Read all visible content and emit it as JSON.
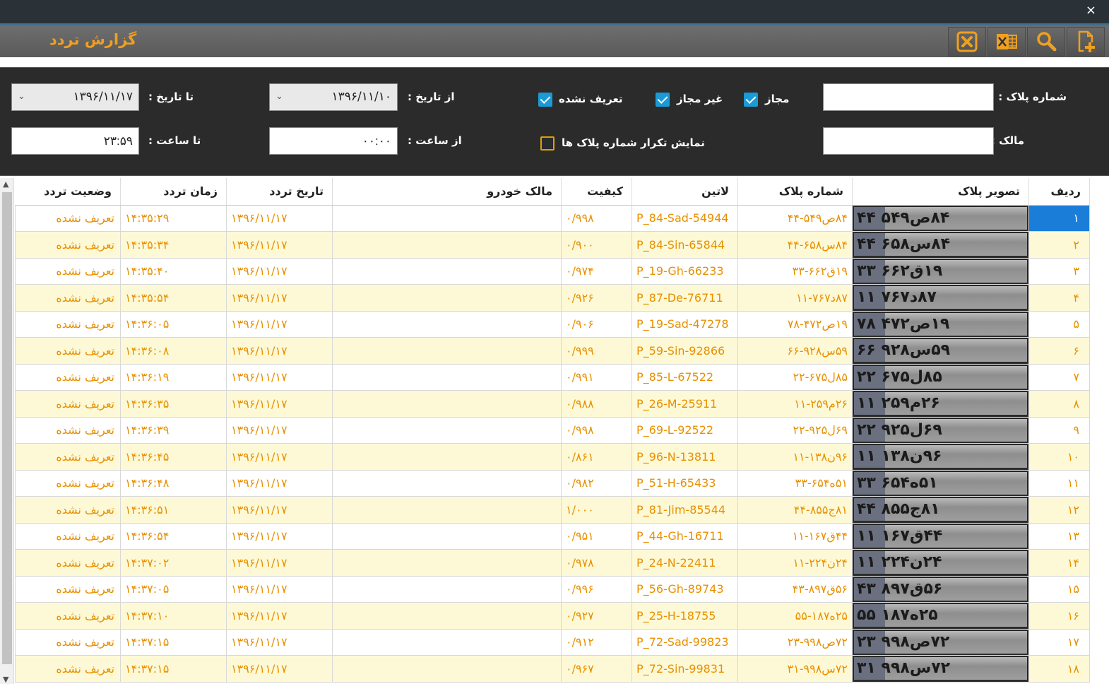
{
  "window": {
    "title": "گزارش تردد",
    "close_glyph": "×"
  },
  "toolbar": {
    "buttons": [
      {
        "name": "add-icon",
        "color": "#f0a020"
      },
      {
        "name": "search-icon",
        "color": "#f0a020"
      },
      {
        "name": "excel-icon",
        "color": "#f0a020"
      },
      {
        "name": "close-icon",
        "color": "#f0a020"
      }
    ]
  },
  "filters": {
    "plate_label": "شماره پلاک :",
    "owner_label": "مالک :",
    "plate_value": "",
    "owner_value": "",
    "allowed_label": "مجاز",
    "allowed_checked": true,
    "not_allowed_label": "غیر مجاز",
    "not_allowed_checked": true,
    "undefined_label": "تعریف نشده",
    "undefined_checked": true,
    "show_repeat_label": "نمایش تکرار شماره پلاک ها",
    "show_repeat_checked": false,
    "from_date_label": "از تاریخ :",
    "from_date_value": "۱۳۹۶/۱۱/۱۰",
    "to_date_label": "تا تاریخ :",
    "to_date_value": "۱۳۹۶/۱۱/۱۷",
    "from_time_label": "از ساعت :",
    "from_time_value": "۰۰:۰۰",
    "to_time_label": "تا ساعت :",
    "to_time_value": "۲۳:۵۹"
  },
  "table": {
    "headers": {
      "index": "ردیف",
      "image": "تصویر پلاک",
      "plate": "شماره پلاک",
      "latin": "لاتین",
      "quality": "کیفیت",
      "owner": "مالک خودرو",
      "date": "تاریخ تردد",
      "time": "زمان تردد",
      "status": "وضعیت تردد"
    },
    "rows": [
      {
        "index": "۱",
        "plate": "۸۴ص۵۴۹-۴۴",
        "image_text": "۸۴ص۵۴۹ ۴۴",
        "latin": "P_84-Sad-54944",
        "quality": "۰/۹۹۸",
        "owner": "",
        "date": "۱۳۹۶/۱۱/۱۷",
        "time": "۱۴:۳۵:۲۹",
        "status": "تعریف نشده"
      },
      {
        "index": "۲",
        "plate": "۸۴س۶۵۸-۴۴",
        "image_text": "۸۴س۶۵۸ ۴۴",
        "latin": "P_84-Sin-65844",
        "quality": "۰/۹۰۰",
        "owner": "",
        "date": "۱۳۹۶/۱۱/۱۷",
        "time": "۱۴:۳۵:۳۴",
        "status": "تعریف نشده"
      },
      {
        "index": "۳",
        "plate": "۱۹ق۶۶۲-۳۳",
        "image_text": "۱۹ق۶۶۲ ۳۳",
        "latin": "P_19-Gh-66233",
        "quality": "۰/۹۷۴",
        "owner": "",
        "date": "۱۳۹۶/۱۱/۱۷",
        "time": "۱۴:۳۵:۴۰",
        "status": "تعریف نشده"
      },
      {
        "index": "۴",
        "plate": "۸۷د۷۶۷-۱۱",
        "image_text": "۸۷د۷۶۷ ۱۱",
        "latin": "P_87-De-76711",
        "quality": "۰/۹۲۶",
        "owner": "",
        "date": "۱۳۹۶/۱۱/۱۷",
        "time": "۱۴:۳۵:۵۴",
        "status": "تعریف نشده"
      },
      {
        "index": "۵",
        "plate": "۱۹ص۴۷۲-۷۸",
        "image_text": "۱۹ص۴۷۲ ۷۸",
        "latin": "P_19-Sad-47278",
        "quality": "۰/۹۰۶",
        "owner": "",
        "date": "۱۳۹۶/۱۱/۱۷",
        "time": "۱۴:۳۶:۰۵",
        "status": "تعریف نشده"
      },
      {
        "index": "۶",
        "plate": "۵۹س۹۲۸-۶۶",
        "image_text": "۵۹س۹۲۸ ۶۶",
        "latin": "P_59-Sin-92866",
        "quality": "۰/۹۹۹",
        "owner": "",
        "date": "۱۳۹۶/۱۱/۱۷",
        "time": "۱۴:۳۶:۰۸",
        "status": "تعریف نشده"
      },
      {
        "index": "۷",
        "plate": "۸۵ل۶۷۵-۲۲",
        "image_text": "۸۵ل۶۷۵ ۲۲",
        "latin": "P_85-L-67522",
        "quality": "۰/۹۹۱",
        "owner": "",
        "date": "۱۳۹۶/۱۱/۱۷",
        "time": "۱۴:۳۶:۱۹",
        "status": "تعریف نشده"
      },
      {
        "index": "۸",
        "plate": "۲۶م۲۵۹-۱۱",
        "image_text": "۲۶م۲۵۹ ۱۱",
        "latin": "P_26-M-25911",
        "quality": "۰/۹۸۸",
        "owner": "",
        "date": "۱۳۹۶/۱۱/۱۷",
        "time": "۱۴:۳۶:۳۵",
        "status": "تعریف نشده"
      },
      {
        "index": "۹",
        "plate": "۶۹ل۹۲۵-۲۲",
        "image_text": "۶۹ل۹۲۵ ۲۲",
        "latin": "P_69-L-92522",
        "quality": "۰/۹۹۸",
        "owner": "",
        "date": "۱۳۹۶/۱۱/۱۷",
        "time": "۱۴:۳۶:۳۹",
        "status": "تعریف نشده"
      },
      {
        "index": "۱۰",
        "plate": "۹۶ن۱۳۸-۱۱",
        "image_text": "۹۶ن۱۳۸ ۱۱",
        "latin": "P_96-N-13811",
        "quality": "۰/۸۶۱",
        "owner": "",
        "date": "۱۳۹۶/۱۱/۱۷",
        "time": "۱۴:۳۶:۴۵",
        "status": "تعریف نشده"
      },
      {
        "index": "۱۱",
        "plate": "۵۱ه۶۵۴-۳۳",
        "image_text": "۵۱ه۶۵۴ ۳۳",
        "latin": "P_51-H-65433",
        "quality": "۰/۹۸۲",
        "owner": "",
        "date": "۱۳۹۶/۱۱/۱۷",
        "time": "۱۴:۳۶:۴۸",
        "status": "تعریف نشده"
      },
      {
        "index": "۱۲",
        "plate": "۸۱ج۸۵۵-۴۴",
        "image_text": "۸۱ج۸۵۵ ۴۴",
        "latin": "P_81-Jim-85544",
        "quality": "۱/۰۰۰",
        "owner": "",
        "date": "۱۳۹۶/۱۱/۱۷",
        "time": "۱۴:۳۶:۵۱",
        "status": "تعریف نشده"
      },
      {
        "index": "۱۳",
        "plate": "۴۴ق۱۶۷-۱۱",
        "image_text": "۴۴ق۱۶۷ ۱۱",
        "latin": "P_44-Gh-16711",
        "quality": "۰/۹۵۱",
        "owner": "",
        "date": "۱۳۹۶/۱۱/۱۷",
        "time": "۱۴:۳۶:۵۴",
        "status": "تعریف نشده"
      },
      {
        "index": "۱۴",
        "plate": "۲۴ن۲۲۴-۱۱",
        "image_text": "۲۴ن۲۲۴ ۱۱",
        "latin": "P_24-N-22411",
        "quality": "۰/۹۷۸",
        "owner": "",
        "date": "۱۳۹۶/۱۱/۱۷",
        "time": "۱۴:۳۷:۰۲",
        "status": "تعریف نشده"
      },
      {
        "index": "۱۵",
        "plate": "۵۶ق۸۹۷-۴۳",
        "image_text": "۵۶ق۸۹۷ ۴۳",
        "latin": "P_56-Gh-89743",
        "quality": "۰/۹۹۶",
        "owner": "",
        "date": "۱۳۹۶/۱۱/۱۷",
        "time": "۱۴:۳۷:۰۵",
        "status": "تعریف نشده"
      },
      {
        "index": "۱۶",
        "plate": "۲۵ه۱۸۷-۵۵",
        "image_text": "۲۵ه۱۸۷ ۵۵",
        "latin": "P_25-H-18755",
        "quality": "۰/۹۲۷",
        "owner": "",
        "date": "۱۳۹۶/۱۱/۱۷",
        "time": "۱۴:۳۷:۱۰",
        "status": "تعریف نشده"
      },
      {
        "index": "۱۷",
        "plate": "۷۲ص۹۹۸-۲۳",
        "image_text": "۷۲ص۹۹۸ ۲۳",
        "latin": "P_72-Sad-99823",
        "quality": "۰/۹۱۲",
        "owner": "",
        "date": "۱۳۹۶/۱۱/۱۷",
        "time": "۱۴:۳۷:۱۵",
        "status": "تعریف نشده"
      },
      {
        "index": "۱۸",
        "plate": "۷۲س۹۹۸-۳۱",
        "image_text": "۷۲س۹۹۸ ۳۱",
        "latin": "P_72-Sin-99831",
        "quality": "۰/۹۶۷",
        "owner": "",
        "date": "۱۳۹۶/۱۱/۱۷",
        "time": "۱۴:۳۷:۱۵",
        "status": "تعریف نشده"
      }
    ],
    "selected_index": 0
  },
  "colors": {
    "accent": "#f0a020",
    "row_text": "#e89000",
    "selected": "#1a7ed8",
    "checkbox": "#1a9ad6"
  }
}
